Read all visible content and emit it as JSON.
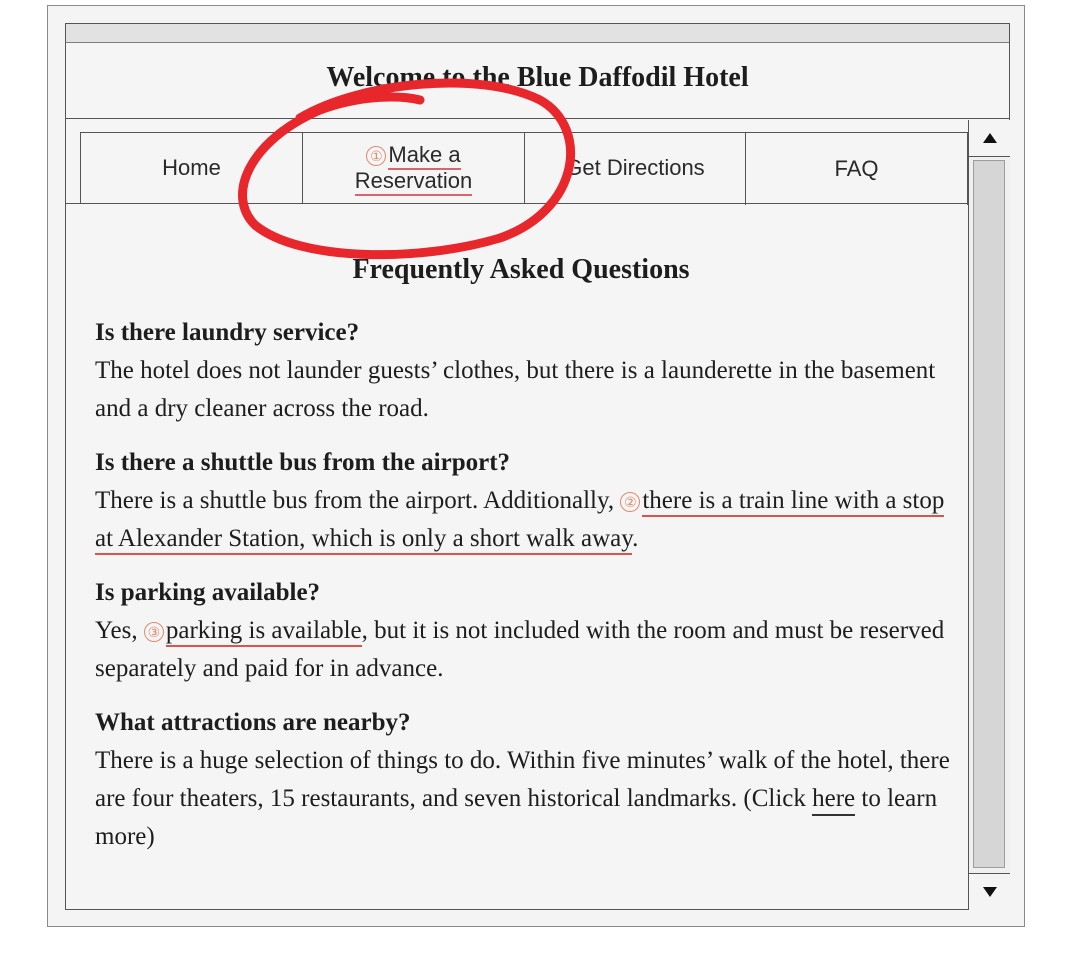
{
  "window": {
    "title": "Welcome to the Blue Daffodil Hotel"
  },
  "tabs": [
    {
      "label": "Home"
    },
    {
      "number": "①",
      "line1": "Make a",
      "line2": "Reservation"
    },
    {
      "label": "Get Directions"
    },
    {
      "label": "FAQ"
    }
  ],
  "faq": {
    "heading": "Frequently Asked Questions",
    "items": [
      {
        "question": "Is there laundry service?",
        "answer": "The hotel does not launder guests’ clothes, but there is a launderette in the basement and a dry cleaner across the road."
      },
      {
        "question": "Is there a shuttle bus from the airport?",
        "answer_before": "There is a shuttle bus from the airport. Additionally, ",
        "number": "②",
        "answer_highlight": "there is a train line with a stop at Alexander Station, which is only a short walk away",
        "answer_after": "."
      },
      {
        "question": "Is parking available?",
        "answer_before": "Yes, ",
        "number": "③",
        "answer_highlight": "parking is available",
        "answer_after": ", but it is not included with the room and must be reserved separately and paid for in advance."
      },
      {
        "question": "What attractions are nearby?",
        "answer_before": "There is a huge selection of things to do. Within five minutes’ walk of the hotel, there are four theaters, 15 restaurants, and seven historical landmarks. (Click ",
        "link_text": "here",
        "answer_after": " to learn more)"
      }
    ]
  },
  "colors": {
    "annotation_red": "#e8272c",
    "underline_red": "#d9534f",
    "number_orange": "#e08a6d"
  }
}
